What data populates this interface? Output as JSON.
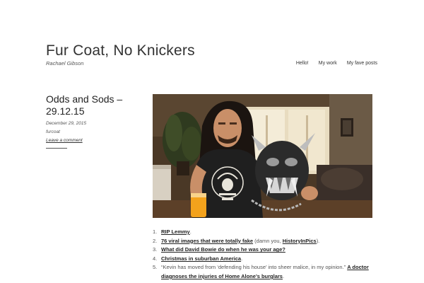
{
  "site": {
    "title": "Fur Coat, No Knickers",
    "description": "Rachael Gibson"
  },
  "nav": {
    "items": [
      "Hello!",
      "My work",
      "My fave posts"
    ]
  },
  "post": {
    "title": "Odds and Sods – 29.12.15",
    "date": "December 29, 2015",
    "author": "furcoat",
    "comment_link": "Leave a comment",
    "image_alt": "Lemmy holding a drink and a Motörhead mask"
  },
  "list": [
    {
      "num": "1.",
      "parts": [
        {
          "t": "RIP Lemmy",
          "link": true
        },
        {
          "t": ".",
          "link": false
        }
      ]
    },
    {
      "num": "2.",
      "parts": [
        {
          "t": "76 viral images that were totally fake",
          "link": true
        },
        {
          "t": " (damn you, ",
          "link": false
        },
        {
          "t": "HistoryInPics",
          "link": true
        },
        {
          "t": ").",
          "link": false
        }
      ]
    },
    {
      "num": "3.",
      "parts": [
        {
          "t": "What did David Bowie do when he was your age?",
          "link": true
        }
      ]
    },
    {
      "num": "4.",
      "parts": [
        {
          "t": "Christmas in suburban America",
          "link": true
        },
        {
          "t": ".",
          "link": false
        }
      ]
    },
    {
      "num": "5.",
      "parts": [
        {
          "t": "“Kevin has moved from ‘defending his house’ into sheer malice, in my opinion.” ",
          "link": false
        },
        {
          "t": "A doctor",
          "link": true
        }
      ]
    },
    {
      "num": "",
      "parts": [
        {
          "t": "diagnoses the injuries of Home Alone’s burglars",
          "link": true
        },
        {
          "t": ".",
          "link": false
        }
      ]
    }
  ],
  "colors": {
    "text": "#333333",
    "link": "#222222",
    "background": "#ffffff"
  }
}
